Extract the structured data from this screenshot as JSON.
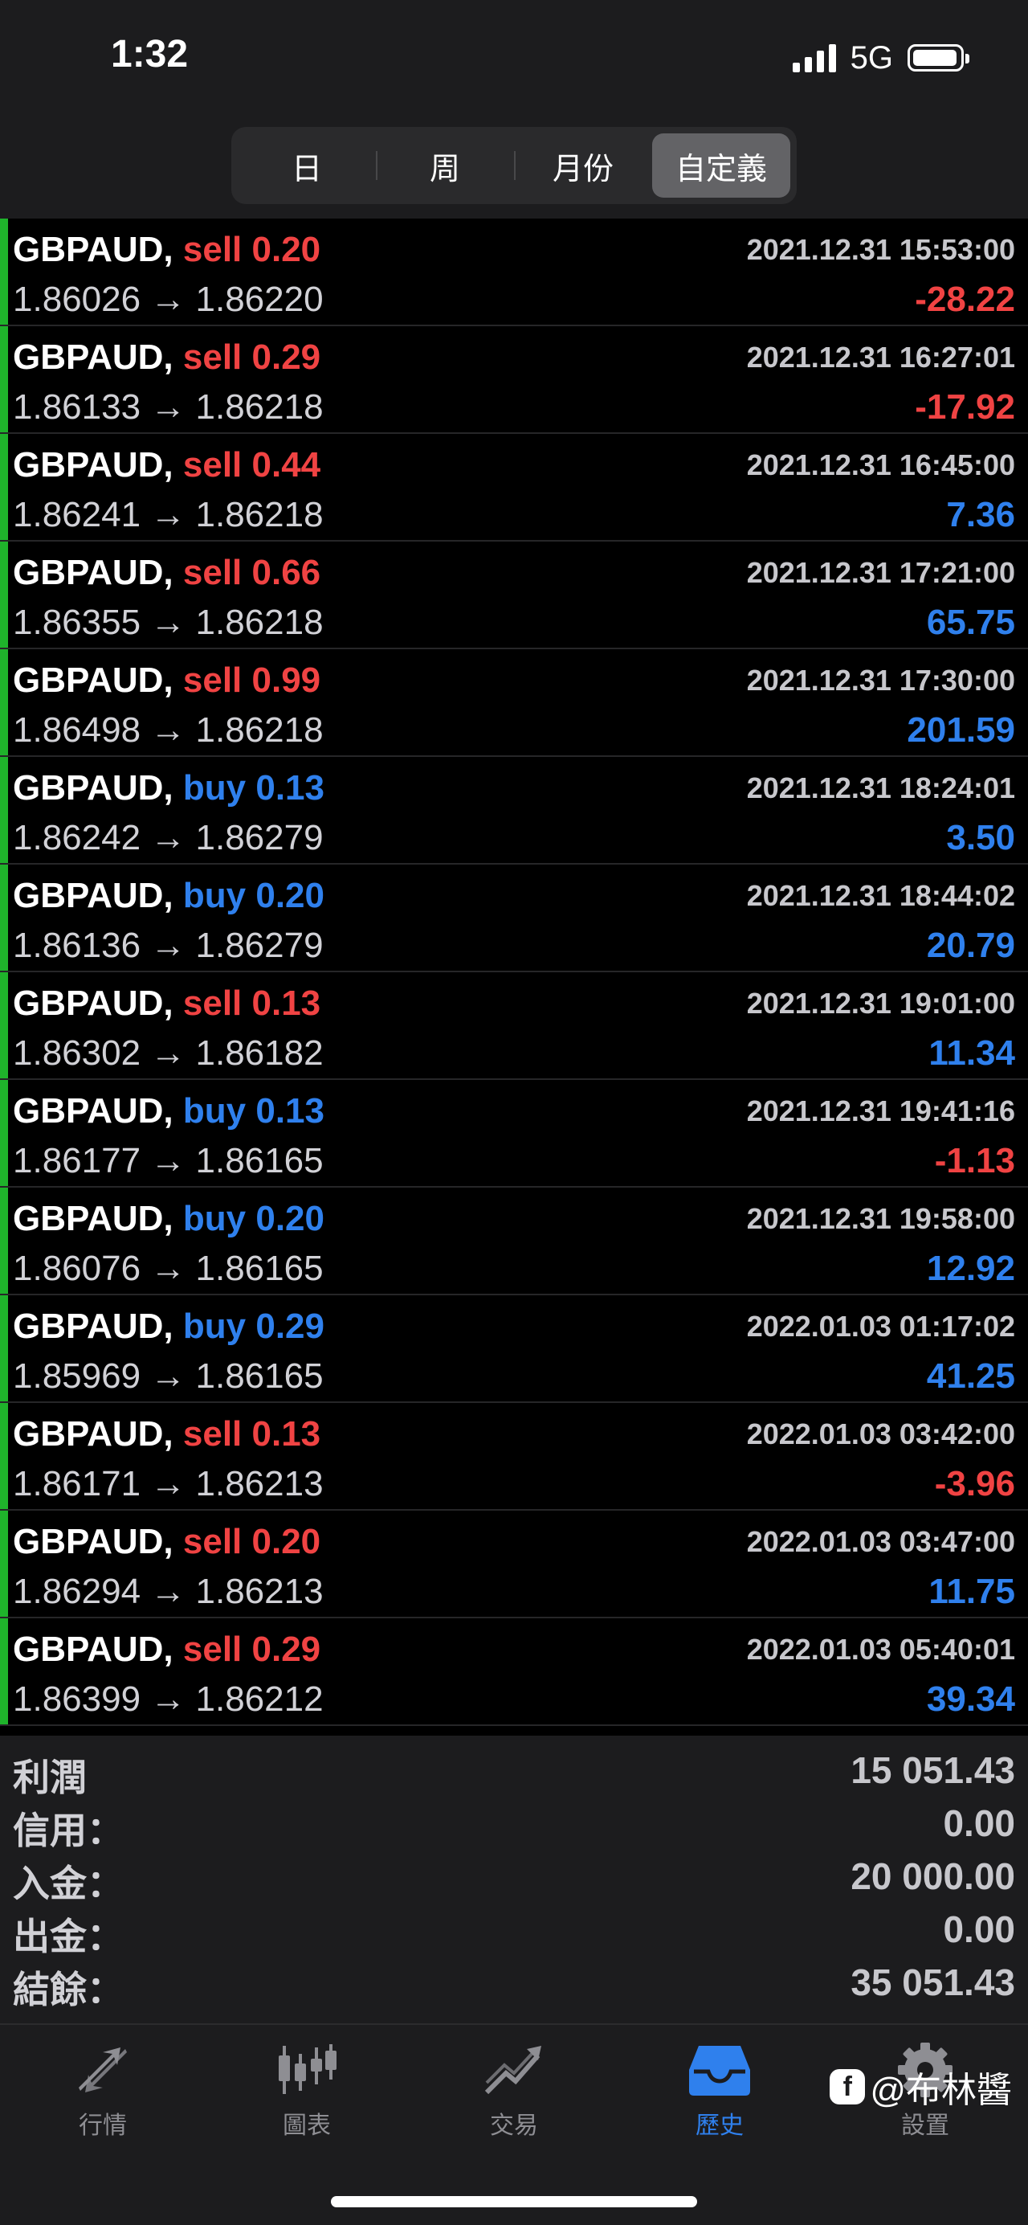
{
  "status_bar": {
    "time": "1:32",
    "network": "5G"
  },
  "period_tabs": [
    {
      "label": "日",
      "active": false
    },
    {
      "label": "周",
      "active": false
    },
    {
      "label": "月份",
      "active": false
    },
    {
      "label": "自定義",
      "active": true
    }
  ],
  "trades": [
    {
      "symbol": "GBPAUD,",
      "side": "sell",
      "volume": "0.20",
      "datetime": "2021.12.31 15:53:00",
      "prices": "1.86026 → 1.86220",
      "profit": "-28.22"
    },
    {
      "symbol": "GBPAUD,",
      "side": "sell",
      "volume": "0.29",
      "datetime": "2021.12.31 16:27:01",
      "prices": "1.86133 → 1.86218",
      "profit": "-17.92"
    },
    {
      "symbol": "GBPAUD,",
      "side": "sell",
      "volume": "0.44",
      "datetime": "2021.12.31 16:45:00",
      "prices": "1.86241 → 1.86218",
      "profit": "7.36"
    },
    {
      "symbol": "GBPAUD,",
      "side": "sell",
      "volume": "0.66",
      "datetime": "2021.12.31 17:21:00",
      "prices": "1.86355 → 1.86218",
      "profit": "65.75"
    },
    {
      "symbol": "GBPAUD,",
      "side": "sell",
      "volume": "0.99",
      "datetime": "2021.12.31 17:30:00",
      "prices": "1.86498 → 1.86218",
      "profit": "201.59"
    },
    {
      "symbol": "GBPAUD,",
      "side": "buy",
      "volume": "0.13",
      "datetime": "2021.12.31 18:24:01",
      "prices": "1.86242 → 1.86279",
      "profit": "3.50"
    },
    {
      "symbol": "GBPAUD,",
      "side": "buy",
      "volume": "0.20",
      "datetime": "2021.12.31 18:44:02",
      "prices": "1.86136 → 1.86279",
      "profit": "20.79"
    },
    {
      "symbol": "GBPAUD,",
      "side": "sell",
      "volume": "0.13",
      "datetime": "2021.12.31 19:01:00",
      "prices": "1.86302 → 1.86182",
      "profit": "11.34"
    },
    {
      "symbol": "GBPAUD,",
      "side": "buy",
      "volume": "0.13",
      "datetime": "2021.12.31 19:41:16",
      "prices": "1.86177 → 1.86165",
      "profit": "-1.13"
    },
    {
      "symbol": "GBPAUD,",
      "side": "buy",
      "volume": "0.20",
      "datetime": "2021.12.31 19:58:00",
      "prices": "1.86076 → 1.86165",
      "profit": "12.92"
    },
    {
      "symbol": "GBPAUD,",
      "side": "buy",
      "volume": "0.29",
      "datetime": "2022.01.03 01:17:02",
      "prices": "1.85969 → 1.86165",
      "profit": "41.25"
    },
    {
      "symbol": "GBPAUD,",
      "side": "sell",
      "volume": "0.13",
      "datetime": "2022.01.03 03:42:00",
      "prices": "1.86171 → 1.86213",
      "profit": "-3.96"
    },
    {
      "symbol": "GBPAUD,",
      "side": "sell",
      "volume": "0.20",
      "datetime": "2022.01.03 03:47:00",
      "prices": "1.86294 → 1.86213",
      "profit": "11.75"
    },
    {
      "symbol": "GBPAUD,",
      "side": "sell",
      "volume": "0.29",
      "datetime": "2022.01.03 05:40:01",
      "prices": "1.86399 → 1.86212",
      "profit": "39.34"
    }
  ],
  "summary": [
    {
      "label": "利潤",
      "value": "15 051.43"
    },
    {
      "label": "信用：",
      "value": "0.00"
    },
    {
      "label": "入金：",
      "value": "20 000.00"
    },
    {
      "label": "出金：",
      "value": "0.00"
    },
    {
      "label": "結餘：",
      "value": "35 051.43"
    }
  ],
  "tabbar": [
    {
      "label": "行情",
      "icon": "quotes-arrows-icon",
      "active": false
    },
    {
      "label": "圖表",
      "icon": "candlestick-chart-icon",
      "active": false
    },
    {
      "label": "交易",
      "icon": "trade-trend-icon",
      "active": false
    },
    {
      "label": "歷史",
      "icon": "history-inbox-icon",
      "active": true
    },
    {
      "label": "設置",
      "icon": "gear-icon",
      "active": false
    }
  ],
  "watermark": {
    "text": "@布林醬",
    "badge": "f"
  },
  "colors": {
    "sell": "#f04343",
    "buy": "#2f80ed",
    "accent_bar": "#1fb32b",
    "active_tab": "#2f80ed"
  }
}
